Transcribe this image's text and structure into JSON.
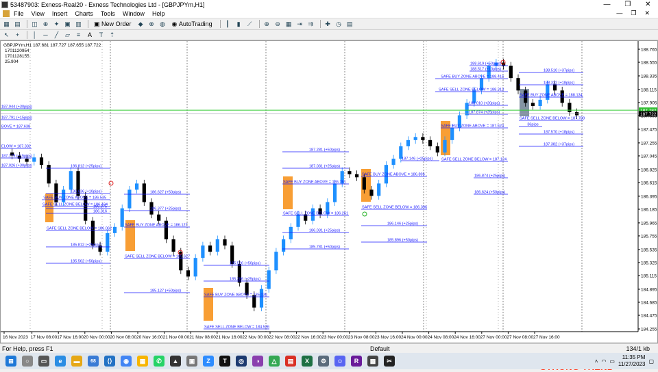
{
  "window": {
    "title": "53487903: Exness-Real20 - Exness Technologies Ltd - [GBPJPYm,H1]"
  },
  "menu": [
    "File",
    "View",
    "Insert",
    "Charts",
    "Tools",
    "Window",
    "Help"
  ],
  "toolbar": {
    "new_order": "New Order",
    "autotrading": "AutoTrading"
  },
  "chart": {
    "symbol_info": "GBPJPYm,H1  187.681 187.727 187.655 187.722",
    "info_lines": [
      "1701120954",
      "1701128155",
      "25.904"
    ],
    "watermark": "STRONG TREND",
    "price_labels": [
      "188.765",
      "188.555",
      "188.335",
      "188.115",
      "187.905",
      "187.695",
      "187.475",
      "187.255",
      "187.045",
      "186.825",
      "186.615",
      "186.395",
      "186.185",
      "185.965",
      "185.755",
      "185.535",
      "185.325",
      "185.115",
      "184.895",
      "184.685",
      "184.475",
      "184.255"
    ],
    "current_price": "187.722",
    "green_price": "187.782",
    "time_labels": [
      "16 Nov 2023",
      "17 Nov 08:00",
      "17 Nov 16:00",
      "20 Nov 00:00",
      "20 Nov 08:00",
      "20 Nov 16:00",
      "21 Nov 00:00",
      "21 Nov 08:00",
      "21 Nov 16:00",
      "22 Nov 00:00",
      "22 Nov 08:00",
      "22 Nov 16:00",
      "23 Nov 00:00",
      "23 Nov 08:00",
      "23 Nov 16:00",
      "24 Nov 00:00",
      "24 Nov 08:00",
      "24 Nov 16:00",
      "27 Nov 00:00",
      "27 Nov 08:00",
      "27 Nov 16:00"
    ],
    "annotations": [
      "188.619 (+50pips)",
      "188.517 (+10pips)",
      "SAFE BUY ZONE ABOVE = 188.416",
      "SAFE SELL ZONE BELOW = 188.313",
      "188.010 (+20pips)",
      "187.874 (+25pips)",
      "SAFE BUY ZONE ABOVE = 187.624",
      "187.146 (+25pips)",
      "SAFE SELL ZONE BELOW = 187.124",
      "186.874 (+25pips)",
      "186.624 (+50pips)",
      "188.510 (+37pips)",
      "188.322 (+18pips)",
      "SAFE BUY ZONE ABOVE = 188.134",
      "SAFE SELL ZONE BELOW = 187.788",
      "187.570 (+18pips)",
      "187.382 (+37pips)",
      "36pips",
      "187.281 (+50pips)",
      "187.031 (+25pips)",
      "SAFE BUY ZONE ABOVE = 186.896",
      "SAFE SELL ZONE BELOW = 186.396",
      "186.146 (+25pips)",
      "185.896 (+50pips)",
      "SAFE BUY ZONE ABOVE = 186.761",
      "SAFE SELL ZONE BELOW = 186.261",
      "186.031 (+25pips)",
      "185.781 (+50pips)",
      "186.627 (+50pips)",
      "186.377 (+25pips)",
      "SAFE BUY ZONE ABOVE = 186.127",
      "SAFE SELL ZONE BELOW = 185.627",
      "185.127 (+50pips)",
      "185.536 (+50pips)",
      "185.286 (+25pips)",
      "SAFE BUY ZONE ABOVE = 185.036",
      "SAFE SELL ZONE BELOW = 184.536",
      "186.812 (+25pips)",
      "186.636 (+10pips)",
      "SAFE BUY ZONE ABOVE = 186.535",
      "SAFE SELL ZONE BELOW = 186.434",
      "186.375",
      "186.316",
      "SAFE SELL ZONE BELOW = 186.062",
      "185.812 (+25pips)",
      "185.562 (+50pips)",
      "187.944 (+30pips)",
      "187.791 (+15pips)",
      "BOVE = 187.638",
      "ELOW = 187.332",
      "187.179 (+15pips)",
      "187.026 (+30pips)"
    ]
  },
  "status": {
    "help": "For Help, press F1",
    "profile": "Default",
    "traffic": "134/1 kb"
  },
  "taskbar": {
    "time": "11:35 PM",
    "date": "11/27/2023",
    "badge": "68"
  },
  "colors": {
    "annotation": "#1a1aff",
    "bull": "#1e90ff",
    "bear": "#000000",
    "zone": "#f7931e",
    "grid": "#555555"
  }
}
